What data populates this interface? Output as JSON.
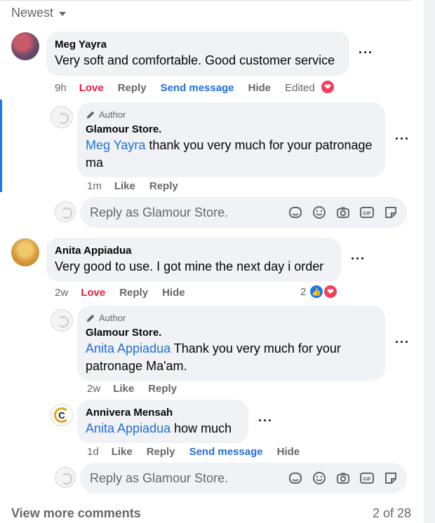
{
  "sort": {
    "label": "Newest"
  },
  "comments": [
    {
      "author": "Meg Yayra",
      "text": "Very soft and comfortable. Good customer service",
      "time": "9h",
      "actions": {
        "love": "Love",
        "reply": "Reply",
        "send": "Send message",
        "hide": "Hide",
        "edited": "Edited"
      },
      "replies": [
        {
          "tag": "Author",
          "author": "Glamour Store.",
          "mention": "Meg Yayra",
          "text": " thank you very much for your patronage ma",
          "time": "1m",
          "actions": {
            "like": "Like",
            "reply": "Reply"
          }
        }
      ],
      "reply_box": {
        "placeholder": "Reply as Glamour Store."
      }
    },
    {
      "author": "Anita Appiadua",
      "text": "Very good to use. I got mine the next day i order",
      "time": "2w",
      "reaction_count": "2",
      "actions": {
        "love": "Love",
        "reply": "Reply",
        "hide": "Hide"
      },
      "replies": [
        {
          "tag": "Author",
          "author": "Glamour Store.",
          "mention": "Anita Appiadua",
          "text": " Thank you very much for your patronage Ma'am.",
          "time": "2w",
          "actions": {
            "like": "Like",
            "reply": "Reply"
          }
        },
        {
          "author": "Annivera Mensah",
          "mention": "Anita Appiadua",
          "text": " how much",
          "time": "1d",
          "actions": {
            "like": "Like",
            "reply": "Reply",
            "send": "Send message",
            "hide": "Hide"
          }
        }
      ],
      "reply_box": {
        "placeholder": "Reply as Glamour Store."
      }
    }
  ],
  "footer": {
    "view_more": "View more comments",
    "count": "2 of 28"
  },
  "colors": {
    "accent": "#1877f2",
    "love": "#e41e3f",
    "link": "#216fdb",
    "bubble": "#f0f2f5",
    "muted": "#65676b"
  },
  "icons": [
    "caret-down-icon",
    "pencil-icon",
    "heart-icon",
    "like-icon",
    "sticker-face-icon",
    "emoji-icon",
    "camera-icon",
    "gif-icon",
    "sticker-icon",
    "more-icon"
  ]
}
